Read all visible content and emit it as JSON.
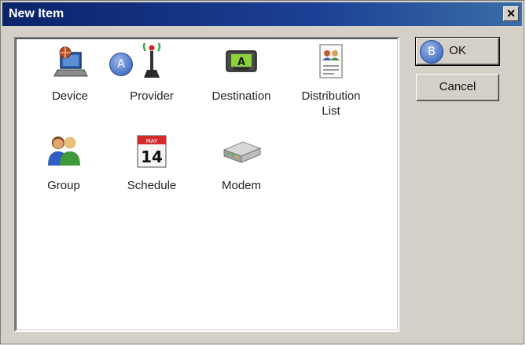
{
  "window": {
    "title": "New Item",
    "close_glyph": "✕"
  },
  "items": [
    {
      "label": "Device",
      "icon": "laptop-device-icon"
    },
    {
      "label": "Provider",
      "icon": "antenna-tower-icon"
    },
    {
      "label": "Destination",
      "icon": "pager-display-icon",
      "screen_text": "A"
    },
    {
      "label": "Distribution\nList",
      "icon": "contact-list-document-icon"
    },
    {
      "label": "Group",
      "icon": "user-group-icon"
    },
    {
      "label": "Schedule",
      "icon": "calendar-icon",
      "month": "MAY",
      "day": "14"
    },
    {
      "label": "Modem",
      "icon": "modem-icon"
    }
  ],
  "buttons": {
    "ok": "OK",
    "cancel": "Cancel"
  },
  "callouts": {
    "a": "A",
    "b": "B"
  },
  "colors": {
    "titlebar": "#0a246a",
    "dialog_bg": "#d4d0c8",
    "callout": "#4a74c4"
  }
}
